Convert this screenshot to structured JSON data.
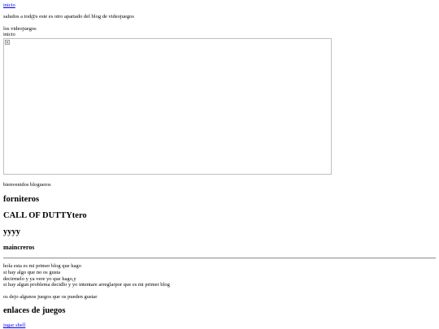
{
  "nav": {
    "home_link": "inicio"
  },
  "intro": {
    "greeting": "saludos a tod@s este es otro apartado del blog de videojuegos"
  },
  "section": {
    "title": "los videojuegos",
    "subtitle": "inicio"
  },
  "banner": {
    "alt": "",
    "icon": "broken-image-icon"
  },
  "welcome": "bienvenidos blogueros",
  "headings": {
    "forniteros": "forniteros",
    "callofduty": "CALL OF DUTTYtero",
    "yyyy": "yyyy",
    "maincreros": "maincreros"
  },
  "body_lines": [
    "hola esta es mi primer blog que hago",
    "si hay algo que no os gusta",
    "decirmelo y ya vere yo que hago,y",
    "si hay algun problema decidlo y yo intentare arreglarpor que es mi primer blog"
  ],
  "games_intro": "os dejo algunos juegos que os pueden gustar",
  "games_heading": "enlaces de juegos",
  "games_links": [
    "jugar shell"
  ]
}
